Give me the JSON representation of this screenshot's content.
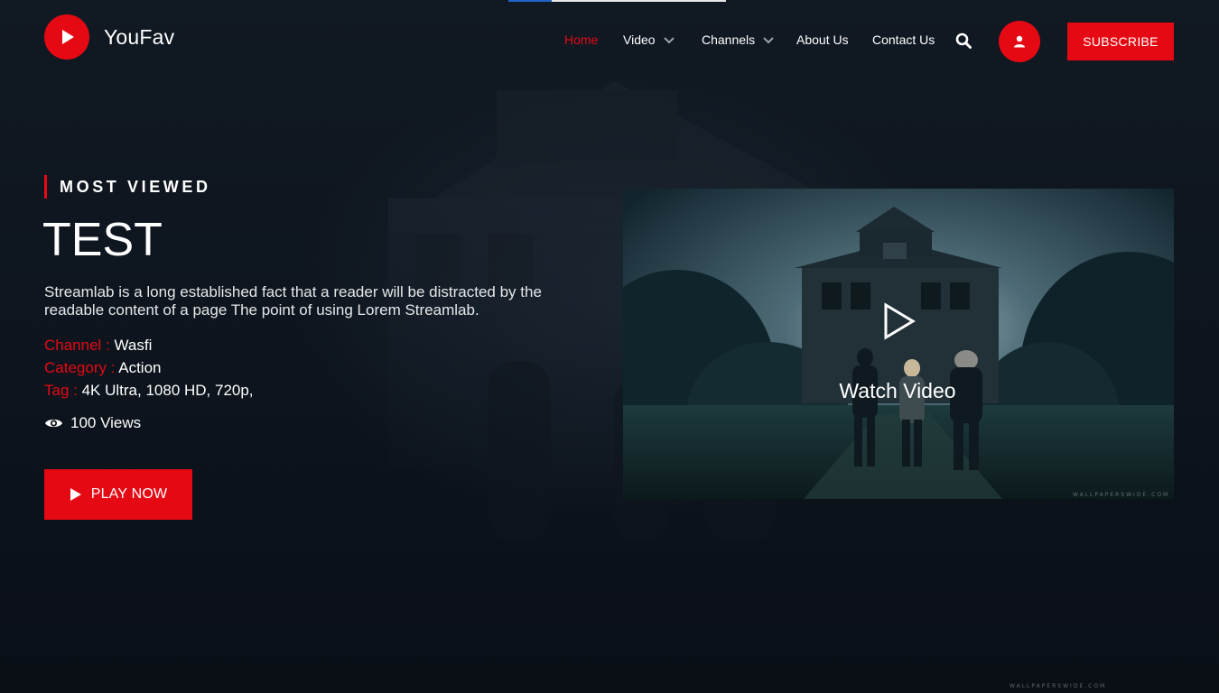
{
  "app": {
    "brand": "YouFav"
  },
  "nav": {
    "items": [
      {
        "label": "Home",
        "active": true,
        "dropdown": false
      },
      {
        "label": "Video",
        "active": false,
        "dropdown": true
      },
      {
        "label": "Channels",
        "active": false,
        "dropdown": true
      },
      {
        "label": "About Us",
        "active": false,
        "dropdown": false
      },
      {
        "label": "Contact Us",
        "active": false,
        "dropdown": false
      }
    ],
    "subscribe_label": "SUBSCRIBE"
  },
  "hero": {
    "eyebrow": "MOST VIEWED",
    "title": "TEST",
    "description": "Streamlab is a long established fact that a reader will be distracted by the readable content of a page The point of using Lorem Streamlab.",
    "channel_label": "Channel :",
    "channel_value": "Wasfi",
    "category_label": "Category :",
    "category_value": "Action",
    "tag_label": "Tag :",
    "tag_value": "4K Ultra, 1080 HD, 720p,",
    "views": "100 Views",
    "play_label": "PLAY NOW"
  },
  "video_card": {
    "watch_label": "Watch Video",
    "watermark": "WALLPAPERSWIDE.COM"
  },
  "top_progress": {
    "value": 0.2
  },
  "colors": {
    "accent": "#e50914",
    "background": "#0b1119",
    "text": "#ffffff",
    "progress": "#1e63c6"
  },
  "icons": {
    "logo": "play-icon",
    "search": "search-icon",
    "user": "user-icon",
    "views": "eye-icon",
    "play_button": "play-icon",
    "video_play": "play-outline-icon",
    "dropdown": "chevron-down-icon"
  }
}
